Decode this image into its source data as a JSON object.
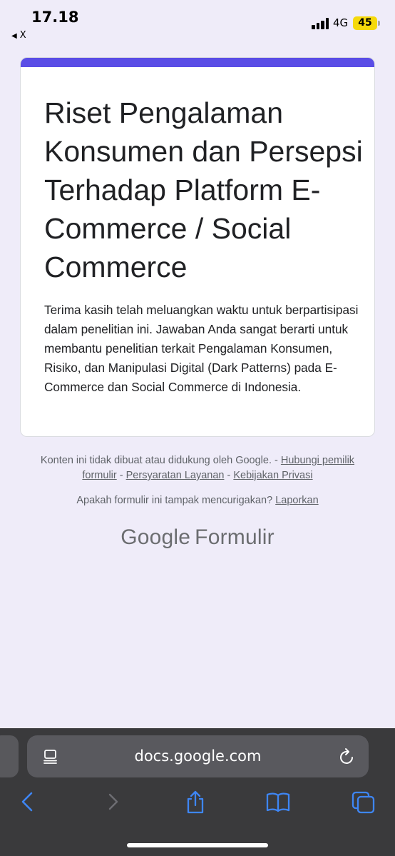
{
  "status_bar": {
    "time": "17.18",
    "back_app": "X",
    "network": "4G",
    "battery": "45"
  },
  "form": {
    "title": "Riset Pengalaman Konsumen dan Persepsi Terhadap Platform E-Commerce / Social Commerce",
    "description": "Terima kasih telah meluangkan waktu untuk berpartisipasi dalam penelitian ini. Jawaban Anda sangat berarti untuk membantu penelitian terkait Pengalaman Konsumen, Risiko, dan Manipulasi Digital (Dark Patterns) pada E-Commerce dan Social Commerce di Indonesia.",
    "accent_color": "#5a4de6"
  },
  "footer": {
    "disclaimer": "Konten ini tidak dibuat atau didukung oleh Google.",
    "sep": " - ",
    "contact_owner": "Hubungi pemilik formulir",
    "terms": "Persyaratan Layanan",
    "privacy": "Kebijakan Privasi",
    "report_question": "Apakah formulir ini tampak mencurigakan?",
    "report_link": "Laporkan",
    "brand_google": "Google",
    "brand_product": "Formulir"
  },
  "browser": {
    "url": "docs.google.com",
    "icons": [
      "reader-icon",
      "reload-icon",
      "back-icon",
      "forward-icon",
      "share-icon",
      "bookmarks-icon",
      "tabs-icon"
    ],
    "icon_color": "#3e86f5"
  }
}
